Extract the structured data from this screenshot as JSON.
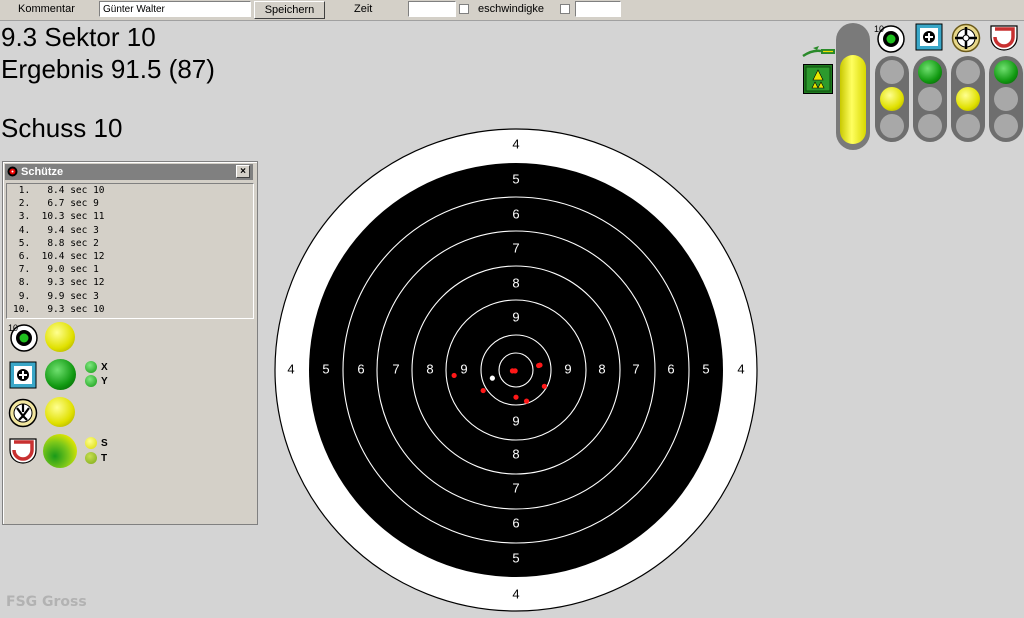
{
  "toolbar": {
    "comment_label": "Kommentar",
    "comment_value": "Günter Walter",
    "save_label": "Speichern",
    "time_label": "Zeit",
    "speed_label": "eschwindigke"
  },
  "header": {
    "last_shot": "9.3 Sektor 10",
    "result": "Ergebnis 91.5 (87)",
    "shot_no": "Schuss 10"
  },
  "panel": {
    "title": "Schütze",
    "close": "×",
    "shots": [
      " 1.   8.4 sec 10",
      " 2.   6.7 sec 9",
      " 3.  10.3 sec 11",
      " 4.   9.4 sec 3",
      " 5.   8.8 sec 2",
      " 6.  10.4 sec 12",
      " 7.   9.0 sec 1",
      " 8.   9.3 sec 12",
      " 9.   9.9 sec 3",
      "10.   9.3 sec 10"
    ],
    "badge": "10",
    "labels": {
      "x": "X",
      "y": "Y",
      "s": "S",
      "t": "T"
    }
  },
  "target": {
    "ring_labels": [
      "4",
      "5",
      "6",
      "7",
      "8",
      "9"
    ],
    "shots": [
      {
        "x": 0.0,
        "y": 16.0
      },
      {
        "x": 6.2,
        "y": 18.3
      },
      {
        "x": 16.7,
        "y": 9.6
      },
      {
        "x": 13.3,
        "y": -2.6
      },
      {
        "x": 14.1,
        "y": -2.9
      },
      {
        "x": -19.3,
        "y": 12.1
      },
      {
        "x": -36.4,
        "y": 3.2
      },
      {
        "x": -2.1,
        "y": 0.5
      },
      {
        "x": -0.5,
        "y": 0.5
      },
      {
        "x": -13.9,
        "y": 4.8
      }
    ],
    "last_shot_index": 9
  },
  "right": {
    "badge": "10"
  },
  "watermark": "FSG Gross",
  "colors": {
    "lamp_green": "#119911",
    "lamp_yellow": "#e6e600",
    "shot_red": "#ff1818",
    "last_shot": "#ffffff"
  }
}
